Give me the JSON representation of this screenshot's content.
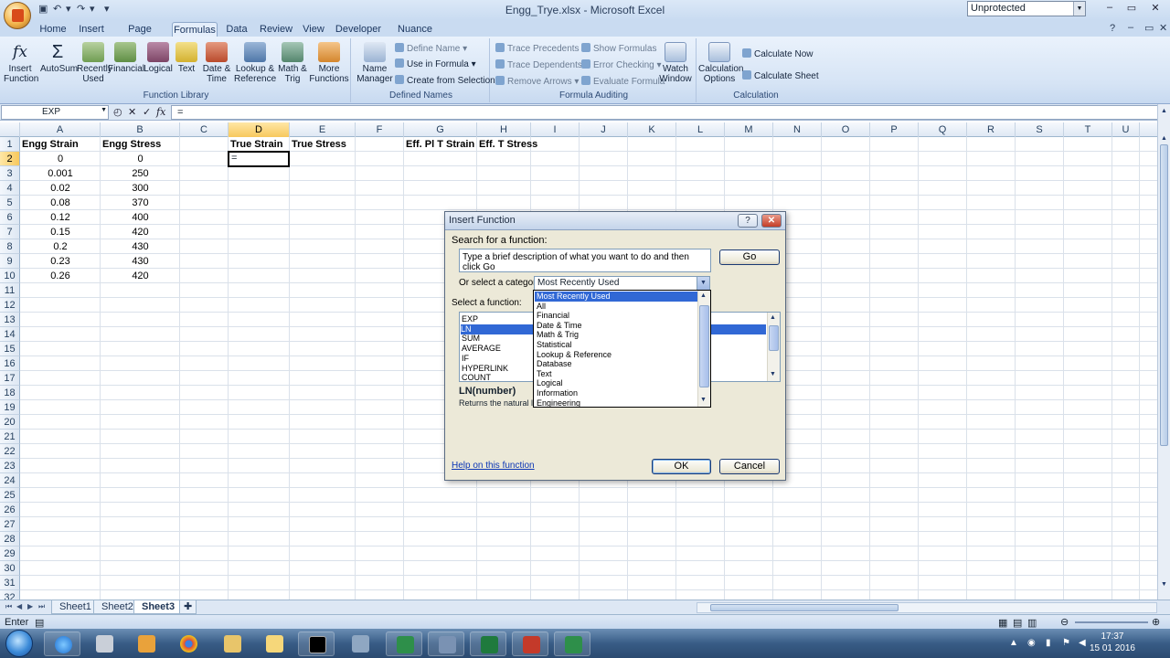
{
  "window": {
    "title": "Engg_Trye.xlsx - Microsoft Excel",
    "protection_status": "Unprotected"
  },
  "tabs": [
    "Home",
    "Insert",
    "Page Layout",
    "Formulas",
    "Data",
    "Review",
    "View",
    "Developer",
    "Nuance PDF"
  ],
  "active_tab": "Formulas",
  "ribbon": {
    "function_library": {
      "label": "Function Library",
      "buttons": [
        {
          "label": "Insert Function",
          "icon": "fx-icon"
        },
        {
          "label": "AutoSum",
          "icon": "sigma-icon"
        },
        {
          "label": "Recently Used",
          "icon": "book-icon"
        },
        {
          "label": "Financial",
          "icon": "book-icon"
        },
        {
          "label": "Logical",
          "icon": "book-icon"
        },
        {
          "label": "Text",
          "icon": "book-icon"
        },
        {
          "label": "Date & Time",
          "icon": "book-icon"
        },
        {
          "label": "Lookup & Reference",
          "icon": "book-icon"
        },
        {
          "label": "Math & Trig",
          "icon": "book-icon"
        },
        {
          "label": "More Functions",
          "icon": "book-icon"
        }
      ]
    },
    "defined_names": {
      "label": "Defined Names",
      "name_manager": "Name Manager",
      "define_name": "Define Name",
      "use_in_formula": "Use in Formula",
      "create_from_selection": "Create from Selection"
    },
    "formula_auditing": {
      "label": "Formula Auditing",
      "trace_precedents": "Trace Precedents",
      "trace_dependents": "Trace Dependents",
      "remove_arrows": "Remove Arrows",
      "show_formulas": "Show Formulas",
      "error_checking": "Error Checking",
      "evaluate_formula": "Evaluate Formula",
      "watch_window": "Watch Window"
    },
    "calculation": {
      "label": "Calculation",
      "calculation_options": "Calculation Options",
      "calculate_now": "Calculate Now",
      "calculate_sheet": "Calculate Sheet"
    }
  },
  "formula_bar": {
    "name_box": "EXP",
    "formula": "="
  },
  "columns": [
    "A",
    "B",
    "C",
    "D",
    "E",
    "F",
    "G",
    "H",
    "I",
    "J",
    "K",
    "L",
    "M",
    "N",
    "O",
    "P",
    "Q",
    "R",
    "S",
    "T",
    "U"
  ],
  "selected_column": "D",
  "rows": [
    "1",
    "2",
    "3",
    "4",
    "5",
    "6",
    "7",
    "8",
    "9",
    "10",
    "11",
    "12",
    "13",
    "14",
    "15",
    "16",
    "17",
    "18",
    "19",
    "20",
    "21",
    "22",
    "23",
    "24",
    "25",
    "26",
    "27",
    "28",
    "29",
    "30",
    "31",
    "32"
  ],
  "selected_row": "2",
  "headers": {
    "A1": "Engg Strain",
    "B1": "Engg Stress",
    "D1": "True Strain",
    "E1": "True Stress",
    "G1": "Eff. Pl T Strain",
    "H1": "Eff. T Stress"
  },
  "data_rows": [
    {
      "strain": "0",
      "stress": "0"
    },
    {
      "strain": "0.001",
      "stress": "250"
    },
    {
      "strain": "0.02",
      "stress": "300"
    },
    {
      "strain": "0.08",
      "stress": "370"
    },
    {
      "strain": "0.12",
      "stress": "400"
    },
    {
      "strain": "0.15",
      "stress": "420"
    },
    {
      "strain": "0.2",
      "stress": "430"
    },
    {
      "strain": "0.23",
      "stress": "430"
    },
    {
      "strain": "0.26",
      "stress": "420"
    }
  ],
  "active_cell_value": "=",
  "sheets": [
    "Sheet1",
    "Sheet2",
    "Sheet3"
  ],
  "active_sheet": "Sheet3",
  "status": {
    "mode": "Enter"
  },
  "taskbar": {
    "time": "17:37",
    "date": "15 01 2016"
  },
  "dialog": {
    "title": "Insert Function",
    "search_label": "Search for a function:",
    "search_value": "Type a brief description of what you want to do and then click Go",
    "go_button": "Go",
    "category_label": "Or select a category:",
    "category_value": "Most Recently Used",
    "select_function_label": "Select a function:",
    "functions": [
      "EXP",
      "LN",
      "SUM",
      "AVERAGE",
      "IF",
      "HYPERLINK",
      "COUNT"
    ],
    "selected_function": "LN",
    "signature": "LN(number)",
    "description": "Returns the natural lo",
    "help_link": "Help on this function",
    "ok_button": "OK",
    "cancel_button": "Cancel",
    "categories": [
      "Most Recently Used",
      "All",
      "Financial",
      "Date & Time",
      "Math & Trig",
      "Statistical",
      "Lookup & Reference",
      "Database",
      "Text",
      "Logical",
      "Information",
      "Engineering"
    ],
    "highlighted_category": "Most Recently Used"
  }
}
